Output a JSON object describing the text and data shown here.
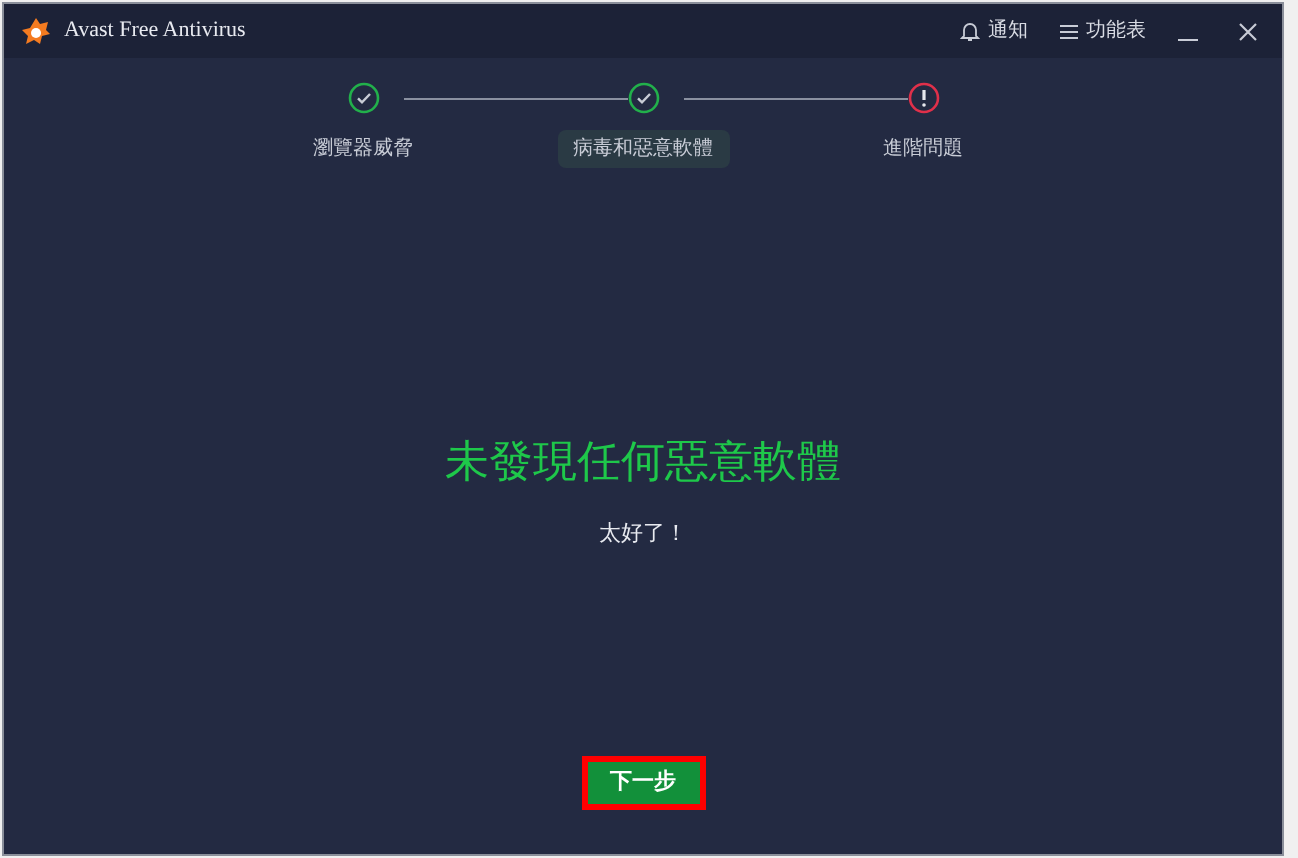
{
  "window": {
    "title": "Avast Free Antivirus",
    "actions": [
      {
        "kind": "bell",
        "label": "通知"
      },
      {
        "kind": "menu",
        "label": "功能表"
      }
    ]
  },
  "steps": [
    {
      "label": "瀏覽器威脅",
      "kind": "done",
      "selected": false
    },
    {
      "label": "病毒和惡意軟體",
      "kind": "done",
      "selected": true
    },
    {
      "label": "進階問題",
      "kind": "warning",
      "selected": false
    }
  ],
  "result": {
    "heading": "未發現任何惡意軟體",
    "subtitle": "太好了！"
  },
  "next_button": {
    "label": "下一步",
    "highlighted": true
  }
}
